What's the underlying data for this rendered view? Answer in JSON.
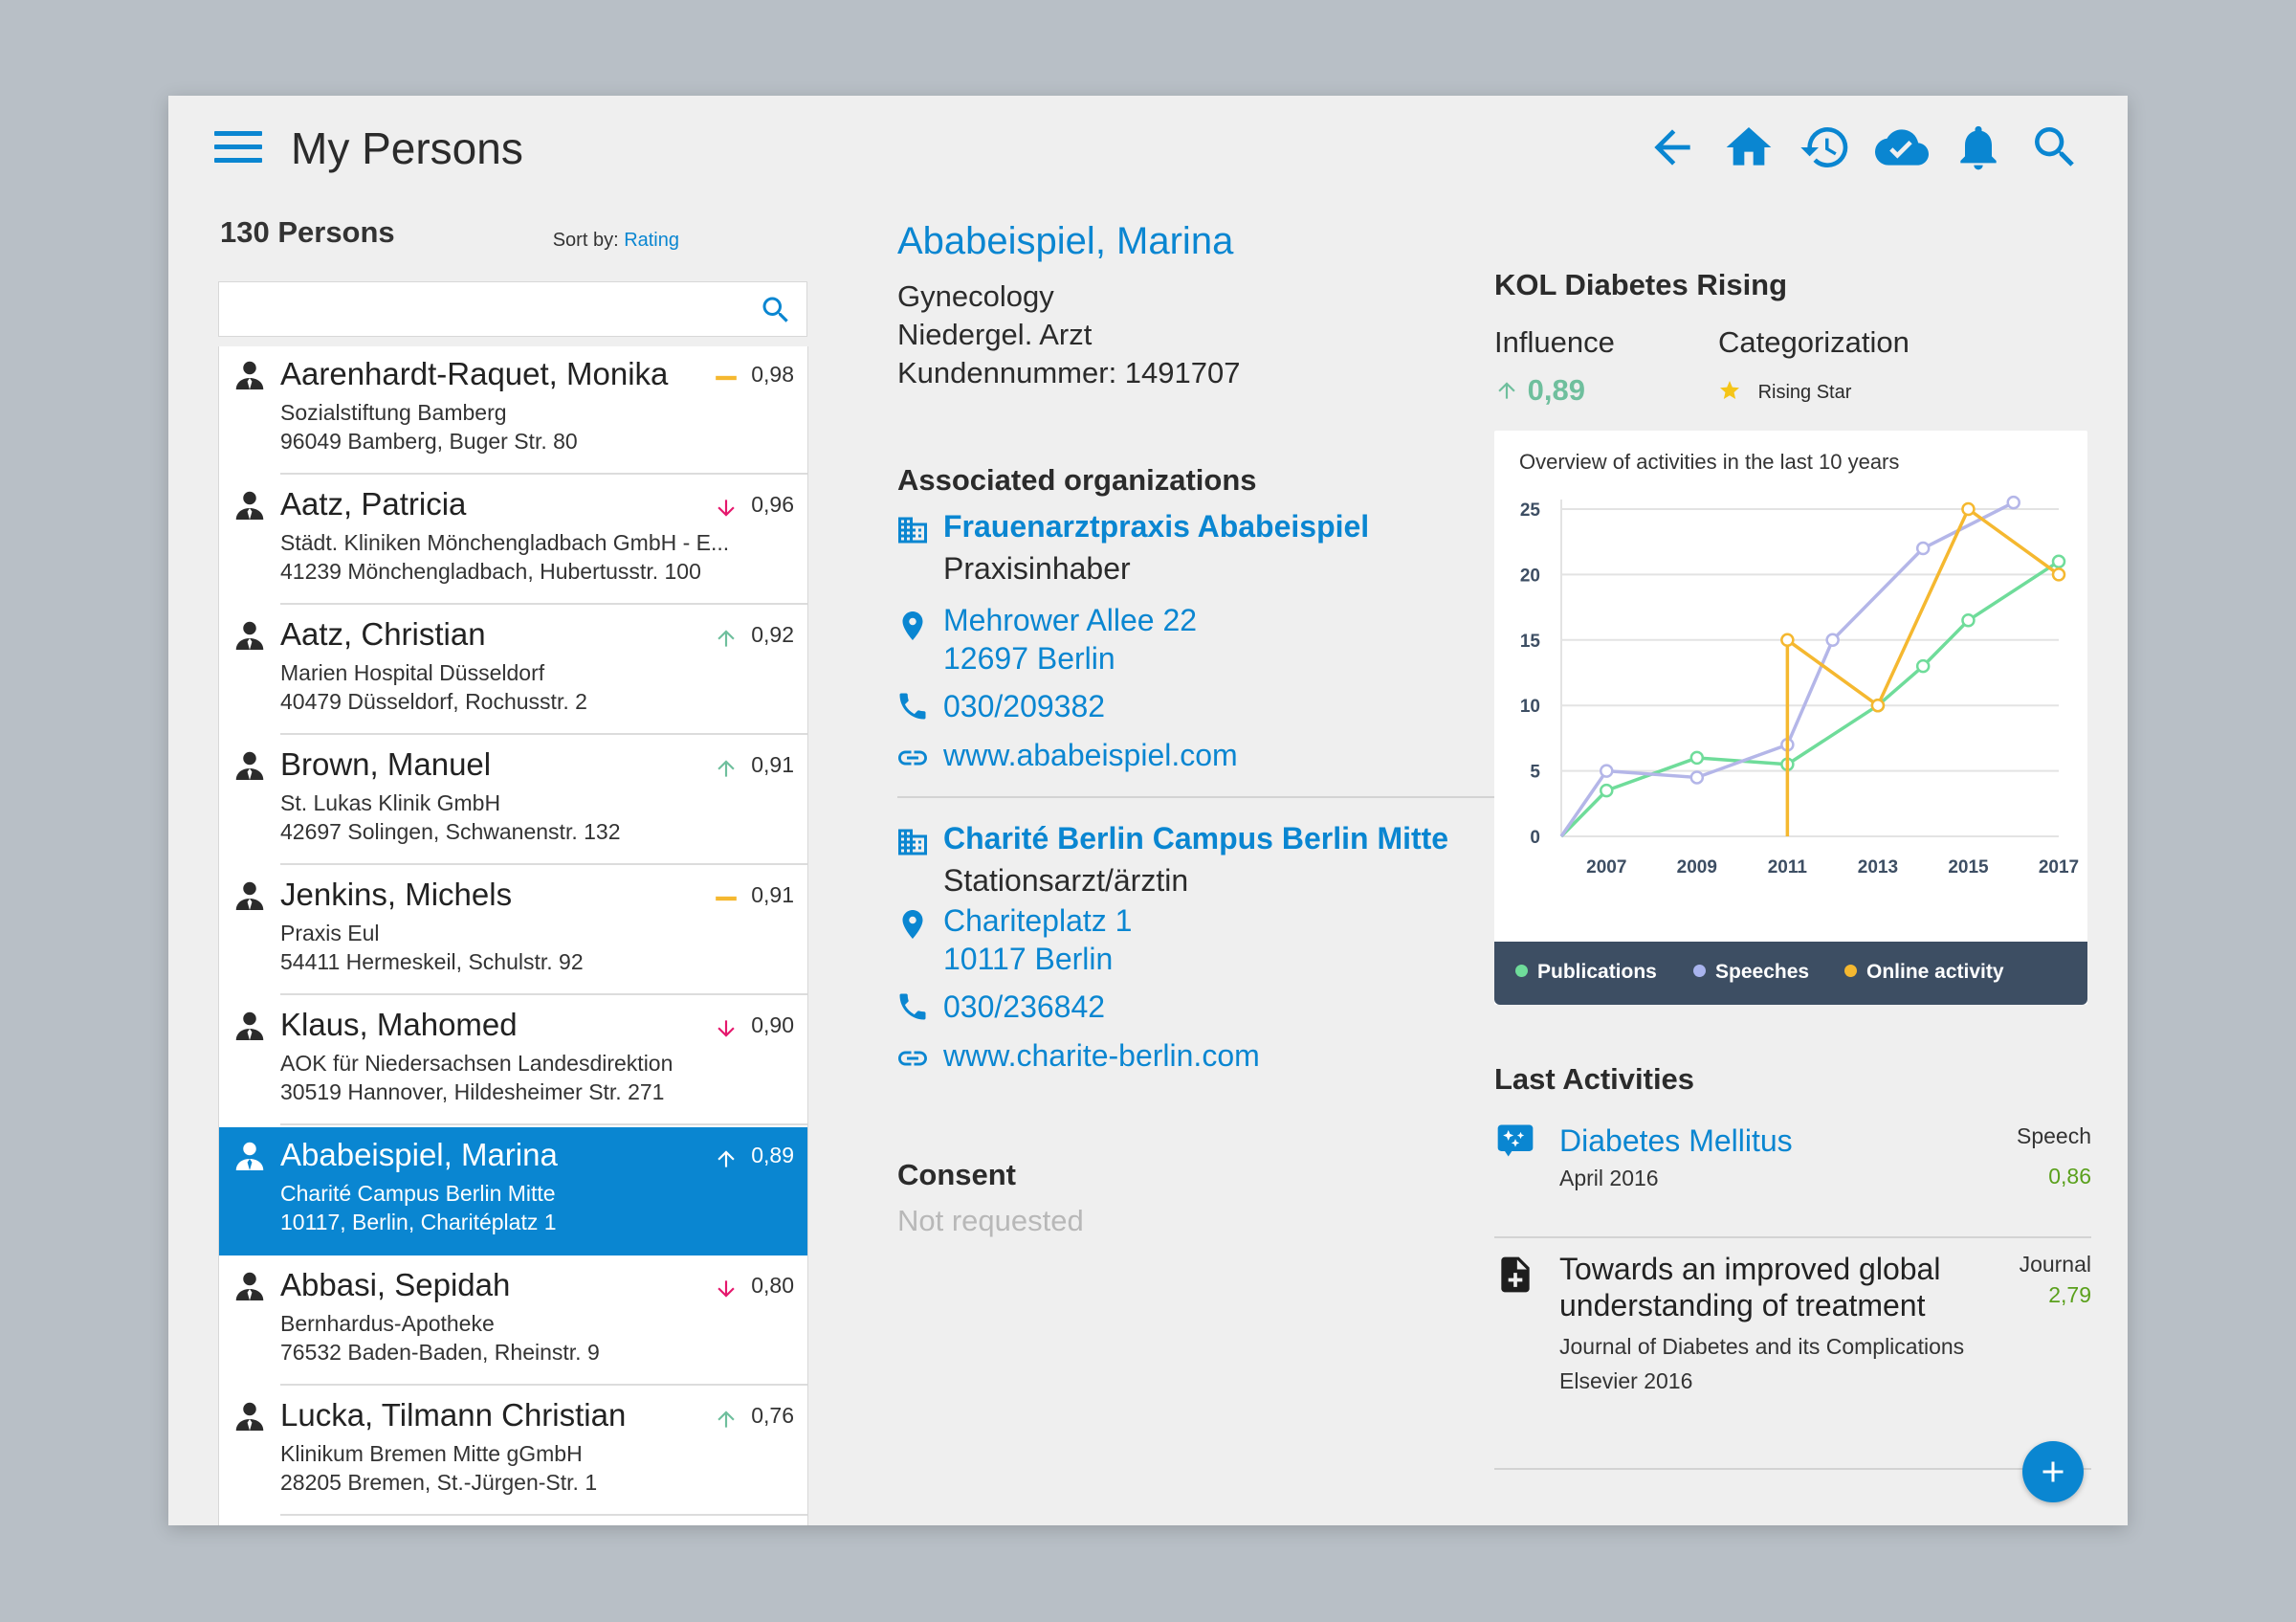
{
  "header": {
    "title": "My Persons",
    "icons": [
      "menu-icon",
      "back-arrow-icon",
      "home-icon",
      "history-icon",
      "cloud-sync-icon",
      "bell-icon",
      "search-icon"
    ]
  },
  "list": {
    "count_label": "130 Persons",
    "sort_prefix": "Sort by:",
    "sort_value": "Rating",
    "search_placeholder": "",
    "persons": [
      {
        "name": "Aarenhardt-Raquet, Monika",
        "org": "Sozialstiftung Bamberg",
        "address": "96049 Bamberg, Buger Str. 80",
        "trend": "flat",
        "score": "0,98",
        "selected": false
      },
      {
        "name": "Aatz, Patricia",
        "org": "Städt. Kliniken Mönchengladbach GmbH - E...",
        "address": "41239 Mönchengladbach, Hubertusstr. 100",
        "trend": "down",
        "score": "0,96",
        "selected": false
      },
      {
        "name": "Aatz, Christian",
        "org": "Marien Hospital Düsseldorf",
        "address": "40479 Düsseldorf, Rochusstr. 2",
        "trend": "up",
        "score": "0,92",
        "selected": false
      },
      {
        "name": "Brown, Manuel",
        "org": "St. Lukas Klinik GmbH",
        "address": "42697 Solingen, Schwanenstr. 132",
        "trend": "up",
        "score": "0,91",
        "selected": false
      },
      {
        "name": "Jenkins, Michels",
        "org": "Praxis Eul",
        "address": "54411 Hermeskeil, Schulstr. 92",
        "trend": "flat",
        "score": "0,91",
        "selected": false
      },
      {
        "name": "Klaus, Mahomed",
        "org": "AOK für Niedersachsen Landesdirektion",
        "address": "30519 Hannover, Hildesheimer Str. 271",
        "trend": "down",
        "score": "0,90",
        "selected": false
      },
      {
        "name": "Ababeispiel, Marina",
        "org": "Charité Campus Berlin Mitte",
        "address": "10117, Berlin, Charitéplatz 1",
        "trend": "up",
        "score": "0,89",
        "selected": true
      },
      {
        "name": "Abbasi, Sepidah",
        "org": "Bernhardus-Apotheke",
        "address": "76532 Baden-Baden, Rheinstr. 9",
        "trend": "down",
        "score": "0,80",
        "selected": false
      },
      {
        "name": "Lucka, Tilmann Christian",
        "org": "Klinikum Bremen Mitte gGmbH",
        "address": "28205 Bremen, St.-Jürgen-Str. 1",
        "trend": "up",
        "score": "0,76",
        "selected": false
      }
    ]
  },
  "detail": {
    "name": "Ababeispiel, Marina",
    "specialty": "Gynecology",
    "type": "Niedergel. Arzt",
    "customer_number": "Kundennummer: 1491707",
    "assoc_title": "Associated organizations",
    "orgs": [
      {
        "name": "Frauenarztpraxis Ababeispiel",
        "role": "Praxisinhaber",
        "street": "Mehrower Allee 22",
        "city": "12697 Berlin",
        "phone": "030/209382",
        "web": "www.ababeispiel.com"
      },
      {
        "name": "Charité Berlin Campus Berlin Mitte",
        "role": "Stationsarzt/ärztin",
        "street": "Chariteplatz 1",
        "city": "10117 Berlin",
        "phone": "030/236842",
        "web": "www.charite-berlin.com"
      }
    ],
    "consent_title": "Consent",
    "consent_value": "Not requested"
  },
  "kol": {
    "title": "KOL Diabetes Rising",
    "influence_label": "Influence",
    "influence_value": "0,89",
    "categorization_label": "Categorization",
    "categorization_value": "Rising Star"
  },
  "chart_data": {
    "type": "line",
    "title": "Overview of activities in the last 10 years",
    "xlim": [
      2006,
      2017
    ],
    "ylim": [
      0,
      25
    ],
    "x_ticks": [
      "2007",
      "2009",
      "2011",
      "2013",
      "2015",
      "2017"
    ],
    "y_ticks": [
      "0",
      "5",
      "10",
      "15",
      "20",
      "25"
    ],
    "grid": true,
    "legend_position": "bottom",
    "series": [
      {
        "name": "Publications",
        "color": "#6fdc9a",
        "x": [
          2006,
          2007,
          2009,
          2011,
          2013,
          2014,
          2015,
          2017
        ],
        "y": [
          0,
          3.5,
          6,
          5.5,
          10,
          13,
          16.5,
          21
        ]
      },
      {
        "name": "Speeches",
        "color": "#b4b6e8",
        "x": [
          2006,
          2007,
          2009,
          2011,
          2012,
          2014,
          2016
        ],
        "y": [
          0,
          5,
          4.5,
          7,
          15,
          22,
          25.5
        ]
      },
      {
        "name": "Online activity",
        "color": "#f5b830",
        "x": [
          2011,
          2011,
          2013,
          2015,
          2017
        ],
        "y": [
          0,
          15,
          10,
          25,
          20
        ]
      }
    ]
  },
  "activities": {
    "title": "Last Activities",
    "items": [
      {
        "icon": "speech-icon",
        "title_lines": [
          "Diabetes Mellitus"
        ],
        "sub_lines": [
          "April 2016"
        ],
        "type": "Speech",
        "score": "0,86",
        "link": true
      },
      {
        "icon": "journal-icon",
        "title_lines": [
          "Towards an improved global",
          "understanding of treatment"
        ],
        "sub_lines": [
          "Journal of Diabetes and its Complications",
          "Elsevier 2016"
        ],
        "type": "Journal",
        "score": "2,79",
        "link": false
      }
    ]
  },
  "colors": {
    "accent": "#0a86d1",
    "up": "#6fbf9d",
    "down": "#e5186d",
    "flat": "#f5b830",
    "score_positive": "#5aa01c"
  }
}
